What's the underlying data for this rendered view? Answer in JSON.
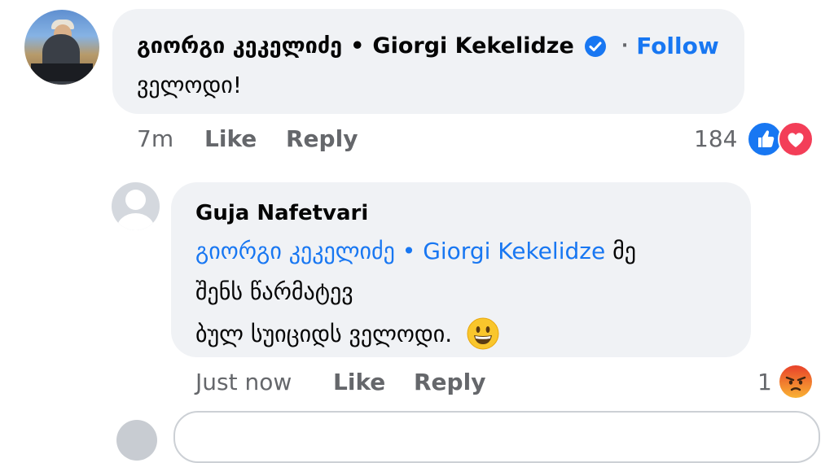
{
  "comment1": {
    "author_ka": "გიორგი კეკელიძე",
    "separator": "•",
    "author_en": "Giorgi Kekelidze",
    "verified_icon": "verified-badge-icon",
    "follow_separator": "·",
    "follow_label": "Follow",
    "text": "ველოდი!",
    "time": "7m",
    "like_label": "Like",
    "reply_label": "Reply",
    "reaction_count": "184",
    "reactions": [
      "like",
      "love"
    ]
  },
  "comment2": {
    "author": "Guja Nafetvari",
    "mention": "გიორგი კეკელიძე • Giorgi Kekelidze",
    "line1_rest": "მე",
    "line2": "შენს წარმატევ",
    "line3": "ბულ სუიციდს ველოდი.",
    "emoji": "grinning-face",
    "time": "Just now",
    "like_label": "Like",
    "reply_label": "Reply",
    "reaction_count": "1",
    "reactions": [
      "angry"
    ]
  },
  "colors": {
    "bubble": "#f0f2f5",
    "link_blue": "#1877f2",
    "meta_gray": "#65676b",
    "love_red": "#f33e58",
    "angry_orange": "#f7714c"
  }
}
